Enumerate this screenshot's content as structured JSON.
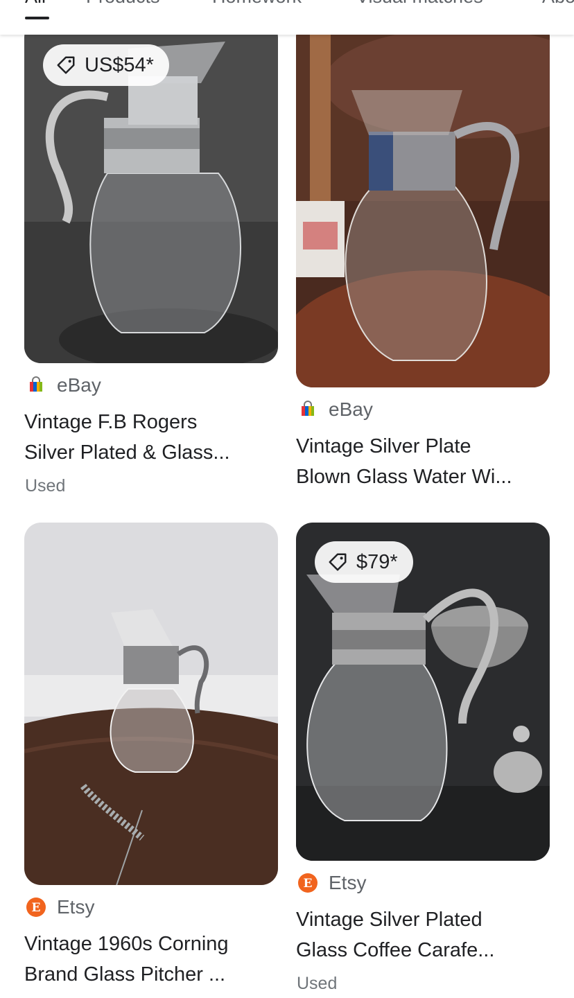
{
  "tabs": [
    {
      "label": "All",
      "active": true
    },
    {
      "label": "Products"
    },
    {
      "label": "Homework"
    },
    {
      "label": "Visual matches"
    },
    {
      "label": "About"
    }
  ],
  "results": [
    {
      "price": "US$54*",
      "source": "eBay",
      "title_line1": "Vintage F.B Rogers",
      "title_line2": "Silver Plated & Glass...",
      "condition": "Used",
      "source_icon": "ebay-bag-icon"
    },
    {
      "source": "eBay",
      "title_line1": "Vintage Silver Plate",
      "title_line2": "Blown Glass Water Wi...",
      "source_icon": "ebay-bag-icon"
    },
    {
      "source": "Etsy",
      "title_line1": "Vintage 1960s Corning",
      "title_line2": "Brand Glass Pitcher ...",
      "source_icon": "etsy-e-icon"
    },
    {
      "price": "$79*",
      "source": "Etsy",
      "title_line1": "Vintage Silver Plated",
      "title_line2": "Glass Coffee Carafe...",
      "condition": "Used",
      "source_icon": "etsy-e-icon"
    }
  ],
  "colors": {
    "etsy_orange": "#f1641e",
    "text_primary": "#202124",
    "text_secondary": "#5f6368"
  }
}
